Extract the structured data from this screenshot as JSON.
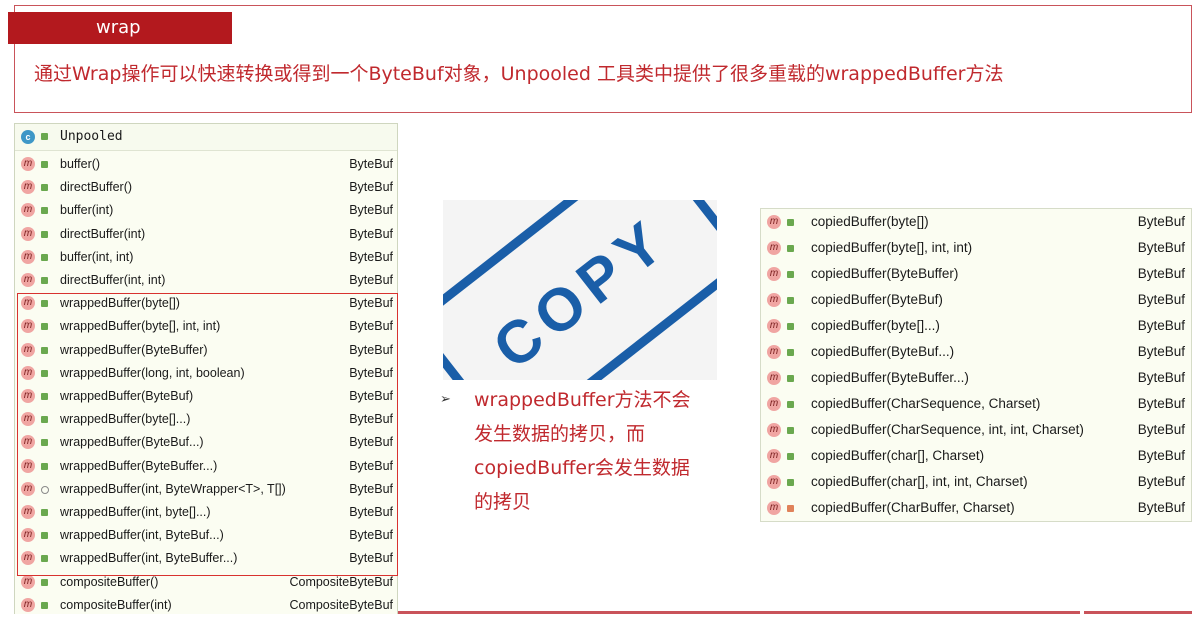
{
  "header": {
    "tag": "wrap",
    "description": "通过Wrap操作可以快速转换或得到一个ByteBuf对象，Unpooled 工具类中提供了很多重载的wrappedBuffer方法"
  },
  "left_panel": {
    "class_icon": "c",
    "class_name": "Unpooled",
    "method_icon": "m",
    "rows": [
      {
        "name": "buffer()",
        "type": "ByteBuf",
        "visibility": "public"
      },
      {
        "name": "directBuffer()",
        "type": "ByteBuf",
        "visibility": "public"
      },
      {
        "name": "buffer(int)",
        "type": "ByteBuf",
        "visibility": "public"
      },
      {
        "name": "directBuffer(int)",
        "type": "ByteBuf",
        "visibility": "public"
      },
      {
        "name": "buffer(int, int)",
        "type": "ByteBuf",
        "visibility": "public"
      },
      {
        "name": "directBuffer(int, int)",
        "type": "ByteBuf",
        "visibility": "public"
      },
      {
        "name": "wrappedBuffer(byte[])",
        "type": "ByteBuf",
        "visibility": "public"
      },
      {
        "name": "wrappedBuffer(byte[], int, int)",
        "type": "ByteBuf",
        "visibility": "public"
      },
      {
        "name": "wrappedBuffer(ByteBuffer)",
        "type": "ByteBuf",
        "visibility": "public"
      },
      {
        "name": "wrappedBuffer(long, int, boolean)",
        "type": "ByteBuf",
        "visibility": "public"
      },
      {
        "name": "wrappedBuffer(ByteBuf)",
        "type": "ByteBuf",
        "visibility": "public"
      },
      {
        "name": "wrappedBuffer(byte[]...)",
        "type": "ByteBuf",
        "visibility": "public"
      },
      {
        "name": "wrappedBuffer(ByteBuf...)",
        "type": "ByteBuf",
        "visibility": "public"
      },
      {
        "name": "wrappedBuffer(ByteBuffer...)",
        "type": "ByteBuf",
        "visibility": "public"
      },
      {
        "name": "wrappedBuffer(int, ByteWrapper<T>, T[])",
        "type": "ByteBuf",
        "visibility": "package"
      },
      {
        "name": "wrappedBuffer(int, byte[]...)",
        "type": "ByteBuf",
        "visibility": "public"
      },
      {
        "name": "wrappedBuffer(int, ByteBuf...)",
        "type": "ByteBuf",
        "visibility": "public"
      },
      {
        "name": "wrappedBuffer(int, ByteBuffer...)",
        "type": "ByteBuf",
        "visibility": "public"
      },
      {
        "name": "compositeBuffer()",
        "type": "CompositeByteBuf",
        "visibility": "public"
      },
      {
        "name": "compositeBuffer(int)",
        "type": "CompositeByteBuf",
        "visibility": "public"
      }
    ]
  },
  "stamp": {
    "text": "COPY",
    "color": "#1a5ea8"
  },
  "note": {
    "bullet": "➢",
    "lines": [
      "wrappedBuffer方法不会",
      "发生数据的拷贝，而",
      "copiedBuffer会发生数据",
      "的拷贝"
    ]
  },
  "right_panel": {
    "rows": [
      {
        "name": "copiedBuffer(byte[])",
        "type": "ByteBuf",
        "visibility": "public"
      },
      {
        "name": "copiedBuffer(byte[], int, int)",
        "type": "ByteBuf",
        "visibility": "public"
      },
      {
        "name": "copiedBuffer(ByteBuffer)",
        "type": "ByteBuf",
        "visibility": "public"
      },
      {
        "name": "copiedBuffer(ByteBuf)",
        "type": "ByteBuf",
        "visibility": "public"
      },
      {
        "name": "copiedBuffer(byte[]...)",
        "type": "ByteBuf",
        "visibility": "public"
      },
      {
        "name": "copiedBuffer(ByteBuf...)",
        "type": "ByteBuf",
        "visibility": "public"
      },
      {
        "name": "copiedBuffer(ByteBuffer...)",
        "type": "ByteBuf",
        "visibility": "public"
      },
      {
        "name": "copiedBuffer(CharSequence, Charset)",
        "type": "ByteBuf",
        "visibility": "public"
      },
      {
        "name": "copiedBuffer(CharSequence, int, int, Charset)",
        "type": "ByteBuf",
        "visibility": "public"
      },
      {
        "name": "copiedBuffer(char[], Charset)",
        "type": "ByteBuf",
        "visibility": "public"
      },
      {
        "name": "copiedBuffer(char[], int, int, Charset)",
        "type": "ByteBuf",
        "visibility": "public"
      },
      {
        "name": "copiedBuffer(CharBuffer, Charset)",
        "type": "ByteBuf",
        "visibility": "private"
      }
    ]
  }
}
